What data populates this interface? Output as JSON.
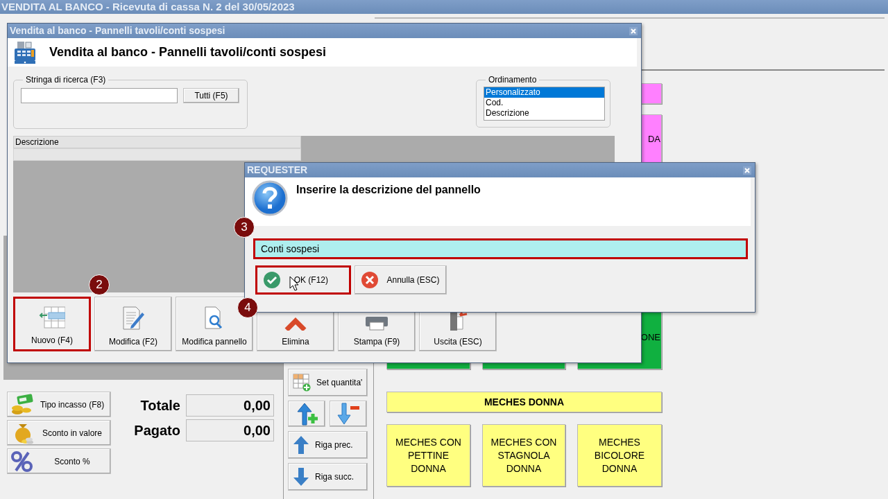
{
  "app": {
    "title": "VENDITA AL BANCO - Ricevuta di cassa N. 2 del 30/05/2023"
  },
  "tiles": [
    {
      "color": "#ff80ff"
    },
    {
      "color": "#ff80ff",
      "text": "DA"
    },
    {
      "color": "#10b040"
    },
    {
      "color": "#10b040"
    },
    {
      "color": "#10b040",
      "text": "ONE"
    }
  ],
  "category": {
    "header": "MECHES DONNA",
    "items": [
      "MECHES CON PETTINE DONNA",
      "MECHES CON STAGNOLA DONNA",
      "MECHES BICOLORE DONNA"
    ]
  },
  "payment_buttons": [
    {
      "label": "Tipo incasso (F8)"
    },
    {
      "label": "Sconto in valore"
    },
    {
      "label": "Sconto %"
    }
  ],
  "totals": [
    {
      "label": "Totale",
      "value": "0,00"
    },
    {
      "label": "Pagato",
      "value": "0,00"
    }
  ],
  "row_buttons": [
    {
      "kind": "set",
      "label": "Set quantita'"
    },
    {
      "kind": "add"
    },
    {
      "kind": "remove"
    },
    {
      "kind": "up",
      "label": "Riga prec."
    },
    {
      "kind": "down",
      "label": "Riga succ."
    }
  ],
  "panels_dialog": {
    "title": "Vendita al banco - Pannelli tavoli/conti sospesi",
    "heading": "Vendita al banco - Pannelli tavoli/conti sospesi",
    "search": {
      "label": "Stringa di ricerca (F3)",
      "button": "Tutti (F5)"
    },
    "sort": {
      "label": "Ordinamento",
      "options": [
        {
          "label": "Personalizzato",
          "selected": true
        },
        {
          "label": "Cod.",
          "selected": false
        },
        {
          "label": "Descrizione",
          "selected": false
        }
      ]
    },
    "grid": {
      "columns": [
        "Descrizione"
      ]
    },
    "buttons": [
      {
        "kind": "new",
        "label": "Nuovo (F4)",
        "highlighted": true
      },
      {
        "kind": "edit",
        "label": "Modifica (F2)",
        "highlighted": false
      },
      {
        "kind": "panel",
        "label": "Modifica pannello",
        "highlighted": false
      },
      {
        "kind": "delete",
        "label": "Elimina",
        "highlighted": false
      },
      {
        "kind": "print",
        "label": "Stampa (F9)",
        "highlighted": false
      },
      {
        "kind": "exit",
        "label": "Uscita (ESC)",
        "highlighted": false
      }
    ]
  },
  "requester": {
    "title": "REQUESTER",
    "message": "Inserire la descrizione del pannello",
    "input": {
      "value": "Conti sospesi",
      "highlighted": true
    },
    "buttons": [
      {
        "kind": "ok",
        "label": "OK (F12)",
        "highlighted": true
      },
      {
        "kind": "cancel",
        "label": "Annulla (ESC)",
        "highlighted": false
      }
    ]
  },
  "step_markers": [
    "2",
    "3",
    "4"
  ]
}
